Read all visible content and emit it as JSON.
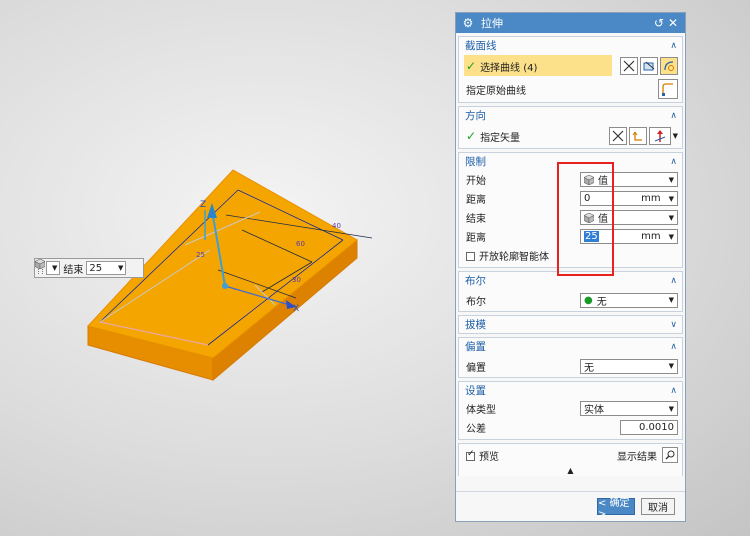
{
  "viewport": {
    "axis_x": "X",
    "axis_z": "Z",
    "dim_labels": [
      "25",
      "60",
      "40",
      "30"
    ],
    "float_bar": {
      "end_label": "结束",
      "end_value": "25"
    }
  },
  "dialog": {
    "title": "拉伸",
    "sections": {
      "section": {
        "header": "截面线",
        "select_curve": "选择曲线 (4)",
        "specify_curve": "指定原始曲线"
      },
      "direction": {
        "header": "方向",
        "specify_vector": "指定矢量"
      },
      "limits": {
        "header": "限制",
        "start_label": "开始",
        "start_value": "值",
        "start_dist_label": "距离",
        "start_dist_value": "0",
        "start_unit": "mm",
        "end_label": "结束",
        "end_value": "值",
        "end_dist_label": "距离",
        "end_dist_value": "25",
        "end_unit": "mm",
        "open_profile": "开放轮廓智能体"
      },
      "boolean": {
        "header": "布尔",
        "label": "布尔",
        "value": "无"
      },
      "draft": {
        "header": "拔模"
      },
      "offset": {
        "header": "偏置",
        "label": "偏置",
        "value": "无"
      },
      "settings": {
        "header": "设置",
        "body_type_label": "体类型",
        "body_type_value": "实体",
        "tolerance_label": "公差",
        "tolerance_value": "0.0010"
      }
    },
    "preview": {
      "label": "预览",
      "show_result": "显示结果"
    },
    "buttons": {
      "ok": "< 确定 >",
      "cancel": "取消"
    }
  },
  "colors": {
    "accent": "#4a89c5",
    "solid": "#f5a000",
    "highlight": "#fce08a",
    "annotation": "#e8231f"
  }
}
